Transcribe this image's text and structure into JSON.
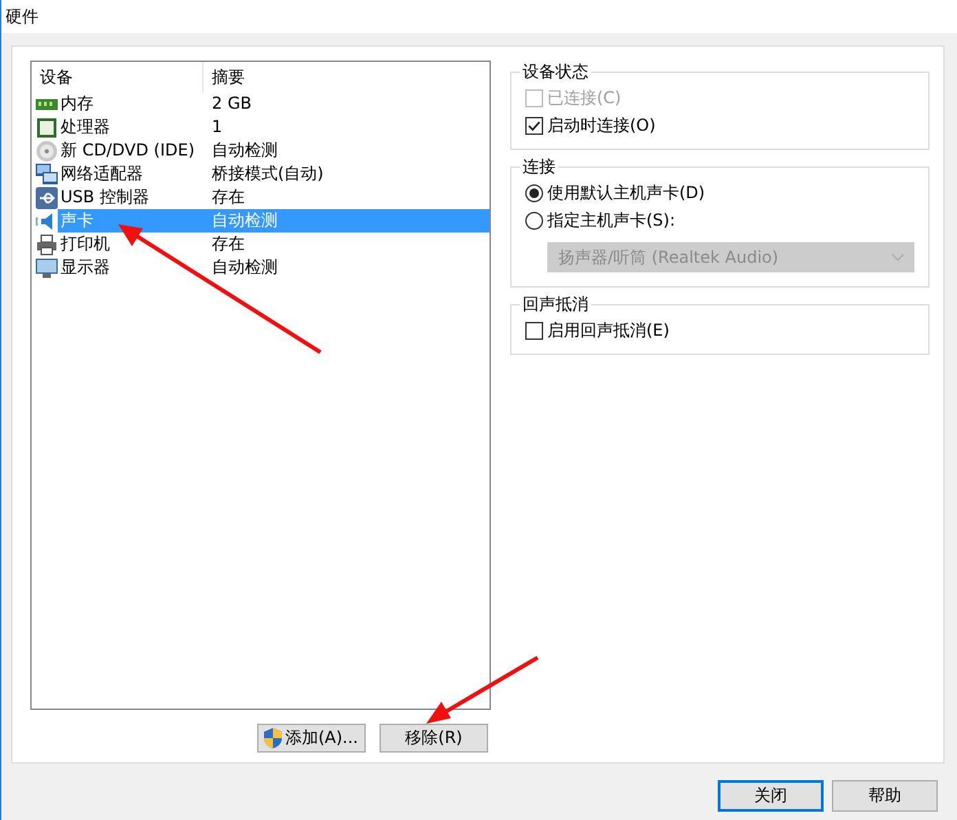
{
  "window": {
    "title": "硬件"
  },
  "device_list": {
    "columns": [
      "设备",
      "摘要"
    ],
    "rows": [
      {
        "device": "内存",
        "summary": "2 GB",
        "selected": false
      },
      {
        "device": "处理器",
        "summary": "1",
        "selected": false
      },
      {
        "device": "新 CD/DVD (IDE)",
        "summary": "自动检测",
        "selected": false
      },
      {
        "device": "网络适配器",
        "summary": "桥接模式(自动)",
        "selected": false
      },
      {
        "device": "USB 控制器",
        "summary": "存在",
        "selected": false
      },
      {
        "device": "声卡",
        "summary": "自动检测",
        "selected": true
      },
      {
        "device": "打印机",
        "summary": "存在",
        "selected": false
      },
      {
        "device": "显示器",
        "summary": "自动检测",
        "selected": false
      }
    ]
  },
  "list_buttons": [
    {
      "label": "添加(A)...",
      "shield": true
    },
    {
      "label": "移除(R)",
      "shield": false
    }
  ],
  "device_status": {
    "title": "设备状态",
    "options": [
      {
        "label": "已连接(C)",
        "checked": false,
        "disabled": true
      },
      {
        "label": "启动时连接(O)",
        "checked": true,
        "disabled": false
      }
    ]
  },
  "connection": {
    "title": "连接",
    "options": [
      {
        "label": "使用默认主机声卡(D)",
        "selected": true
      },
      {
        "label": "指定主机声卡(S):",
        "selected": false
      }
    ],
    "dropdown": {
      "value": "扬声器/听筒 (Realtek Audio)",
      "disabled": true
    }
  },
  "echo_cancel": {
    "title": "回声抵消",
    "options": [
      {
        "label": "启用回声抵消(E)",
        "checked": false,
        "disabled": false
      }
    ]
  },
  "dialog_buttons": [
    {
      "label": "关闭",
      "default": true
    },
    {
      "label": "帮助",
      "default": false
    }
  ]
}
